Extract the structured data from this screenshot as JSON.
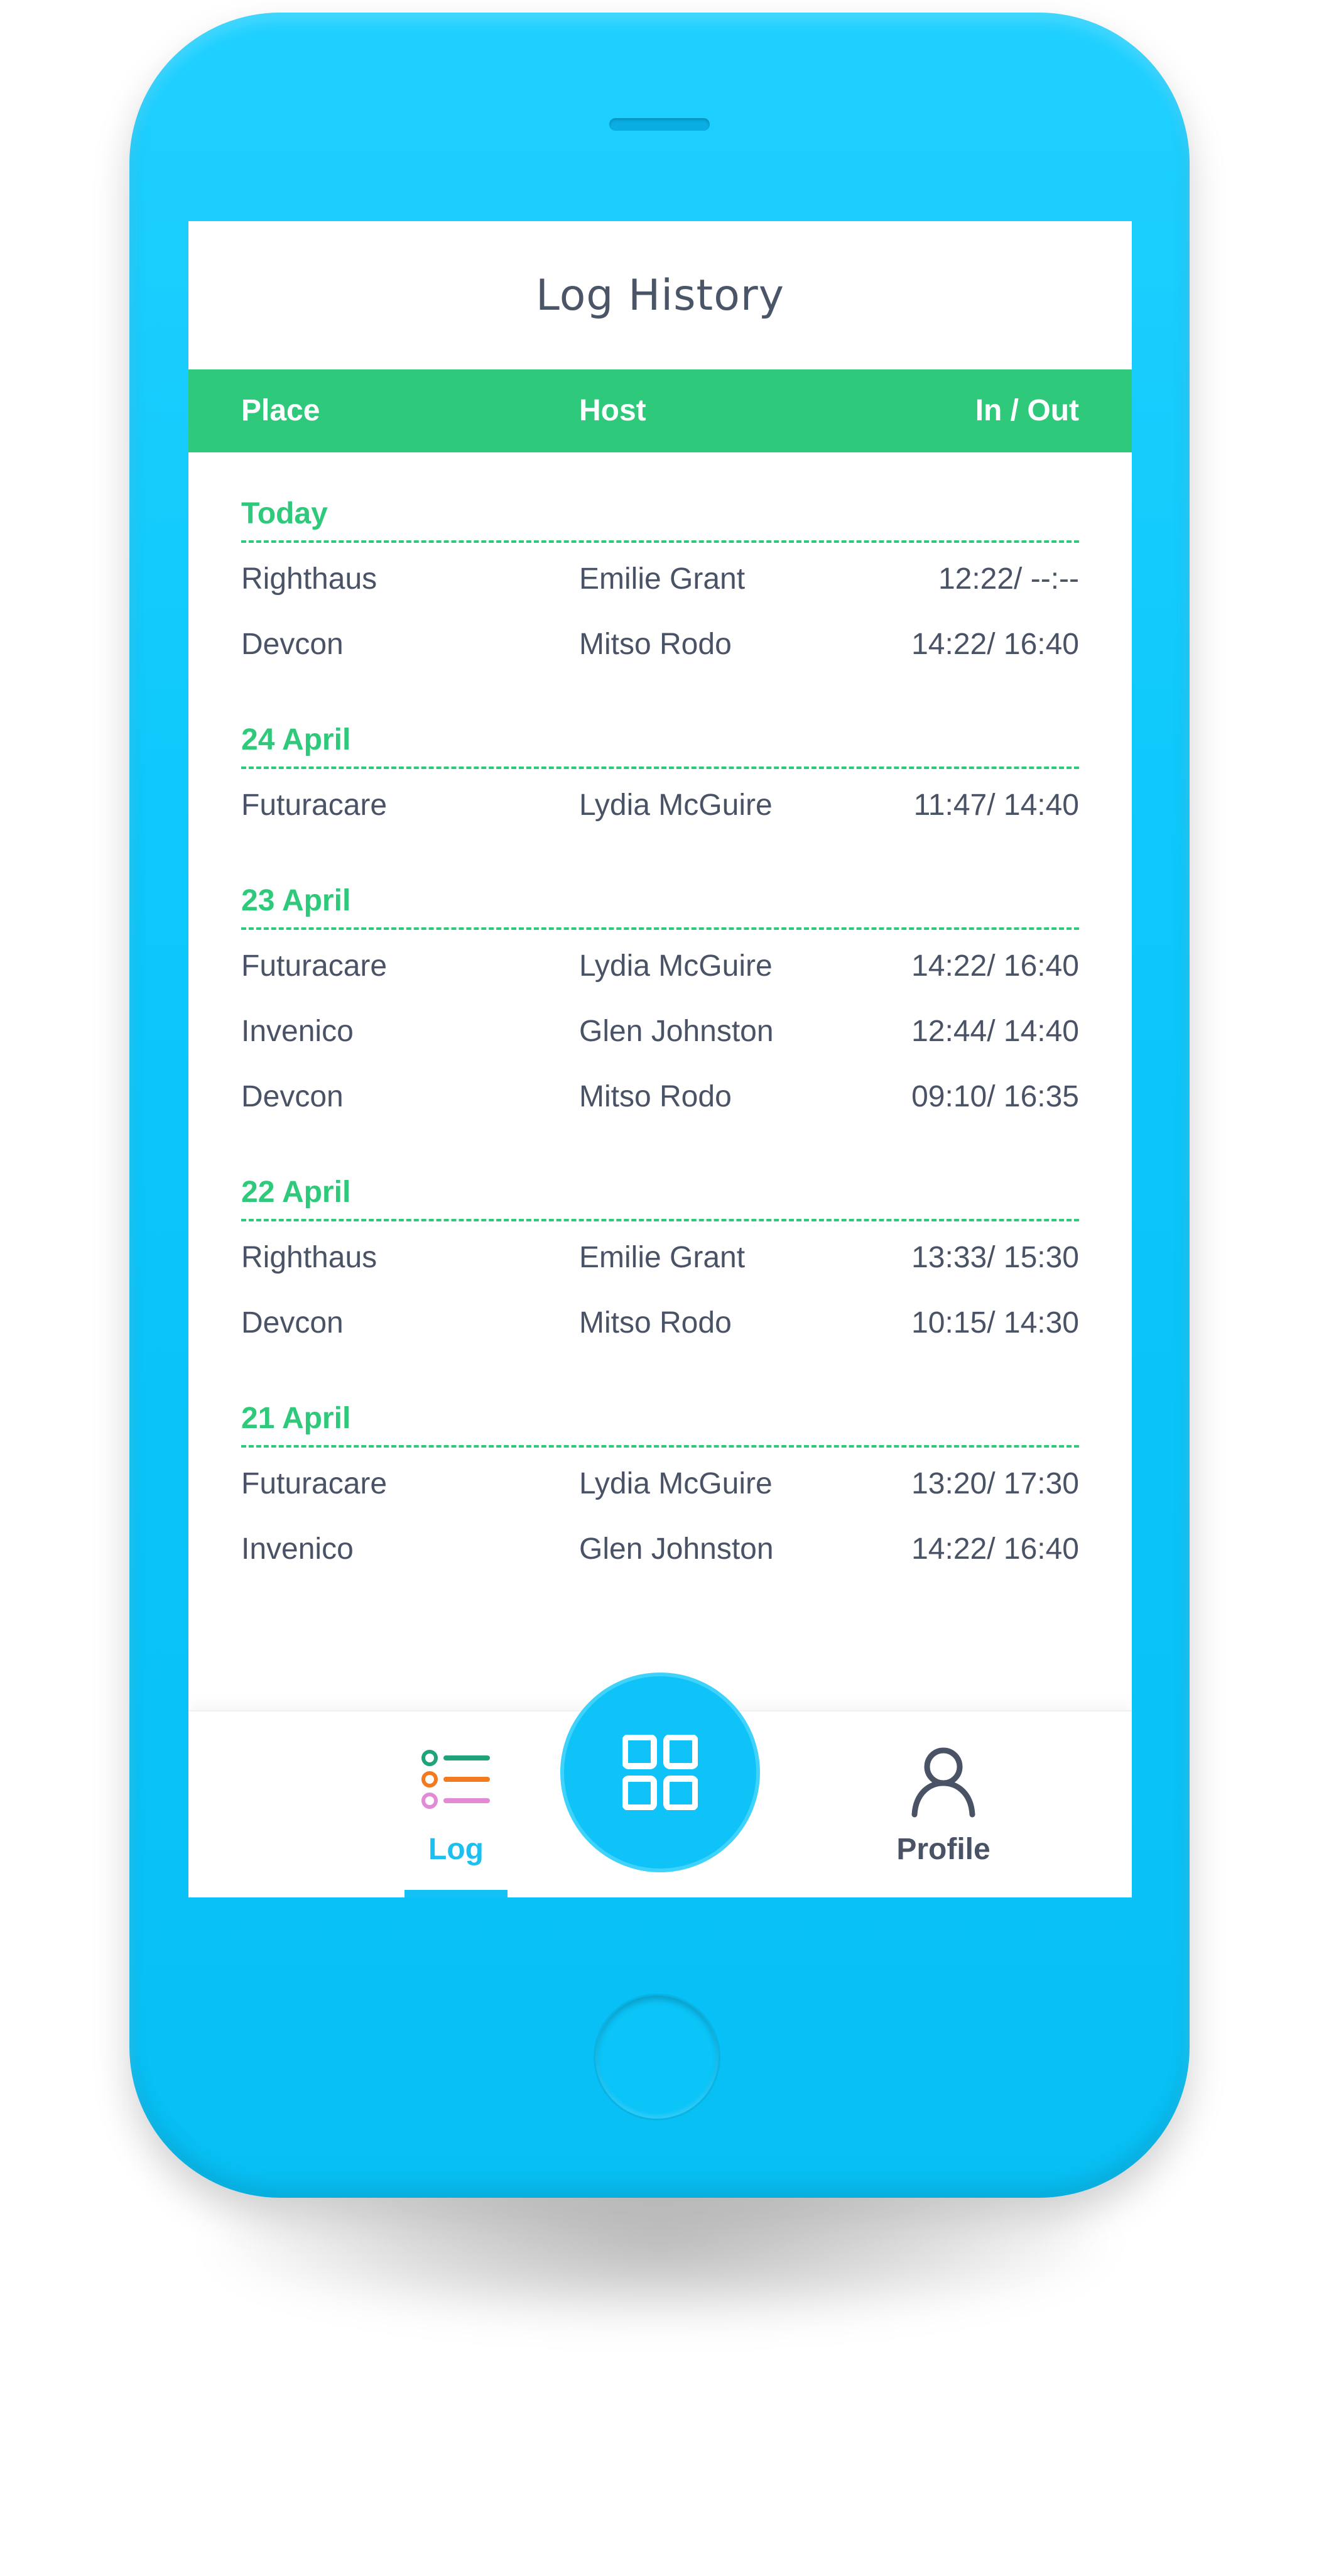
{
  "header": {
    "title": "Log History"
  },
  "columns": {
    "place": "Place",
    "host": "Host",
    "in_out": "In / Out"
  },
  "groups": [
    {
      "label": "Today",
      "rows": [
        {
          "place": "Righthaus",
          "host": "Emilie Grant",
          "time": "12:22/ --:--"
        },
        {
          "place": "Devcon",
          "host": "Mitso Rodo",
          "time": "14:22/ 16:40"
        }
      ]
    },
    {
      "label": "24 April",
      "rows": [
        {
          "place": "Futuracare",
          "host": "Lydia McGuire",
          "time": "11:47/ 14:40"
        }
      ]
    },
    {
      "label": "23 April",
      "rows": [
        {
          "place": "Futuracare",
          "host": "Lydia McGuire",
          "time": "14:22/ 16:40"
        },
        {
          "place": "Invenico",
          "host": "Glen Johnston",
          "time": "12:44/ 14:40"
        },
        {
          "place": "Devcon",
          "host": "Mitso Rodo",
          "time": "09:10/ 16:35"
        }
      ]
    },
    {
      "label": "22 April",
      "rows": [
        {
          "place": "Righthaus",
          "host": "Emilie Grant",
          "time": "13:33/ 15:30"
        },
        {
          "place": "Devcon",
          "host": "Mitso Rodo",
          "time": "10:15/ 14:30"
        }
      ]
    },
    {
      "label": "21 April",
      "rows": [
        {
          "place": "Futuracare",
          "host": "Lydia McGuire",
          "time": "13:20/ 17:30"
        },
        {
          "place": "Invenico",
          "host": "Glen Johnston",
          "time": "14:22/ 16:40"
        }
      ]
    }
  ],
  "tabbar": {
    "log_label": "Log",
    "log_icon": "list-icon",
    "scan_icon": "qr-grid-icon",
    "profile_label": "Profile",
    "profile_icon": "user-icon",
    "active_tab": "Log"
  },
  "colors": {
    "phone_body": "#0bc7fb",
    "accent_green": "#2ec97a",
    "accent_blue": "#13c1f6",
    "text_dark": "#4a5265"
  }
}
